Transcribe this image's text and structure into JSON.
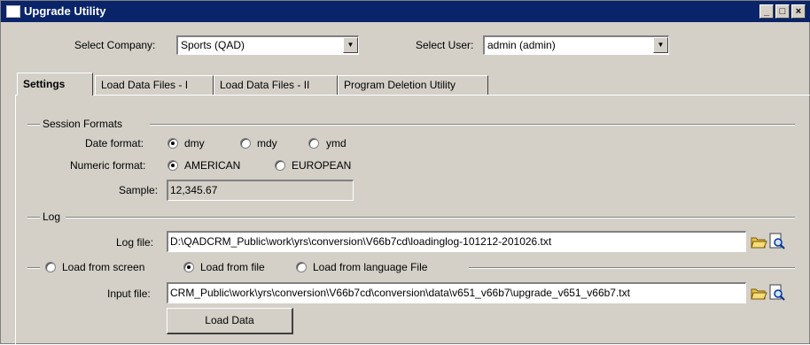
{
  "window": {
    "title": "Upgrade Utility",
    "controls": {
      "minimize": "_",
      "maximize": "□",
      "close": "×"
    }
  },
  "selectors": {
    "company_label": "Select Company:",
    "company_value": "Sports (QAD)",
    "user_label": "Select User:",
    "user_value": "admin (admin)"
  },
  "tabs": [
    {
      "label": "Settings",
      "active": true
    },
    {
      "label": "Load Data Files - I",
      "active": false
    },
    {
      "label": "Load Data Files - II",
      "active": false
    },
    {
      "label": "Program Deletion Utility",
      "active": false
    }
  ],
  "session_formats": {
    "group_label": "Session Formats",
    "date_label": "Date format:",
    "date_options": [
      "dmy",
      "mdy",
      "ymd"
    ],
    "date_selected": "dmy",
    "numeric_label": "Numeric format:",
    "numeric_options": [
      "AMERICAN",
      "EUROPEAN"
    ],
    "numeric_selected": "AMERICAN",
    "sample_label": "Sample:",
    "sample_value": "12,345.67"
  },
  "log": {
    "group_label": "Log",
    "file_label": "Log file:",
    "file_value": "D:\\QADCRM_Public\\work\\yrs\\conversion\\V66b7cd\\loadinglog-101212-201026.txt"
  },
  "load_source": {
    "options": [
      "Load from screen",
      "Load from file",
      "Load from language File"
    ],
    "selected": "Load from file",
    "input_label": "Input file:",
    "input_value": "CRM_Public\\work\\yrs\\conversion\\V66b7cd\\conversion\\data\\v651_v66b7\\upgrade_v651_v66b7.txt",
    "load_button": "Load Data"
  },
  "icons": {
    "open": "folder-open-icon",
    "view": "preview-icon"
  },
  "colors": {
    "titlebar": "#0a246a",
    "face": "#d4d0c8"
  }
}
